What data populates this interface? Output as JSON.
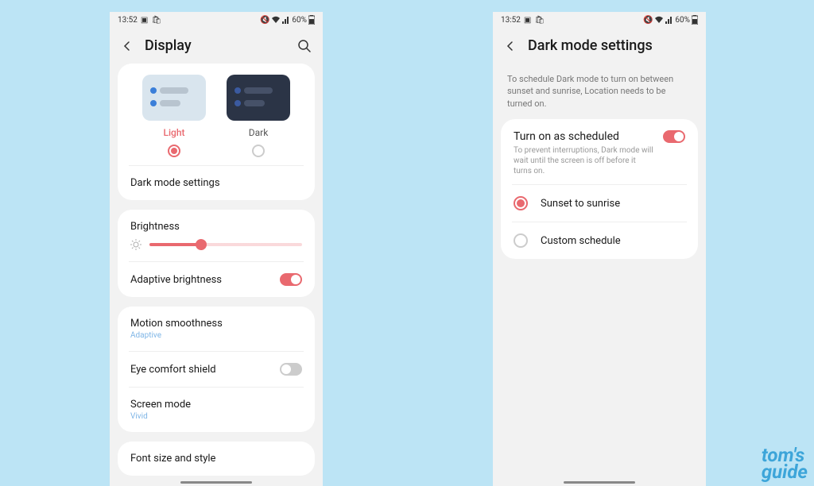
{
  "statusbar": {
    "time": "13:52",
    "battery": "60%"
  },
  "screen1": {
    "title": "Display",
    "theme": {
      "light": "Light",
      "dark": "Dark"
    },
    "darkmode": "Dark mode settings",
    "brightness": "Brightness",
    "adaptive": "Adaptive brightness",
    "motion": {
      "title": "Motion smoothness",
      "sub": "Adaptive"
    },
    "eye": "Eye comfort shield",
    "screenmode": {
      "title": "Screen mode",
      "sub": "Vivid"
    },
    "font": "Font size and style"
  },
  "screen2": {
    "title": "Dark mode settings",
    "desc": "To schedule Dark mode to turn on between sunset and sunrise, Location needs to be turned on.",
    "schedule": {
      "title": "Turn on as scheduled",
      "sub": "To prevent interruptions, Dark mode will wait until the screen is off before it turns on."
    },
    "opt1": "Sunset to sunrise",
    "opt2": "Custom schedule"
  },
  "watermark": {
    "l1": "tom's",
    "l2": "guide"
  }
}
